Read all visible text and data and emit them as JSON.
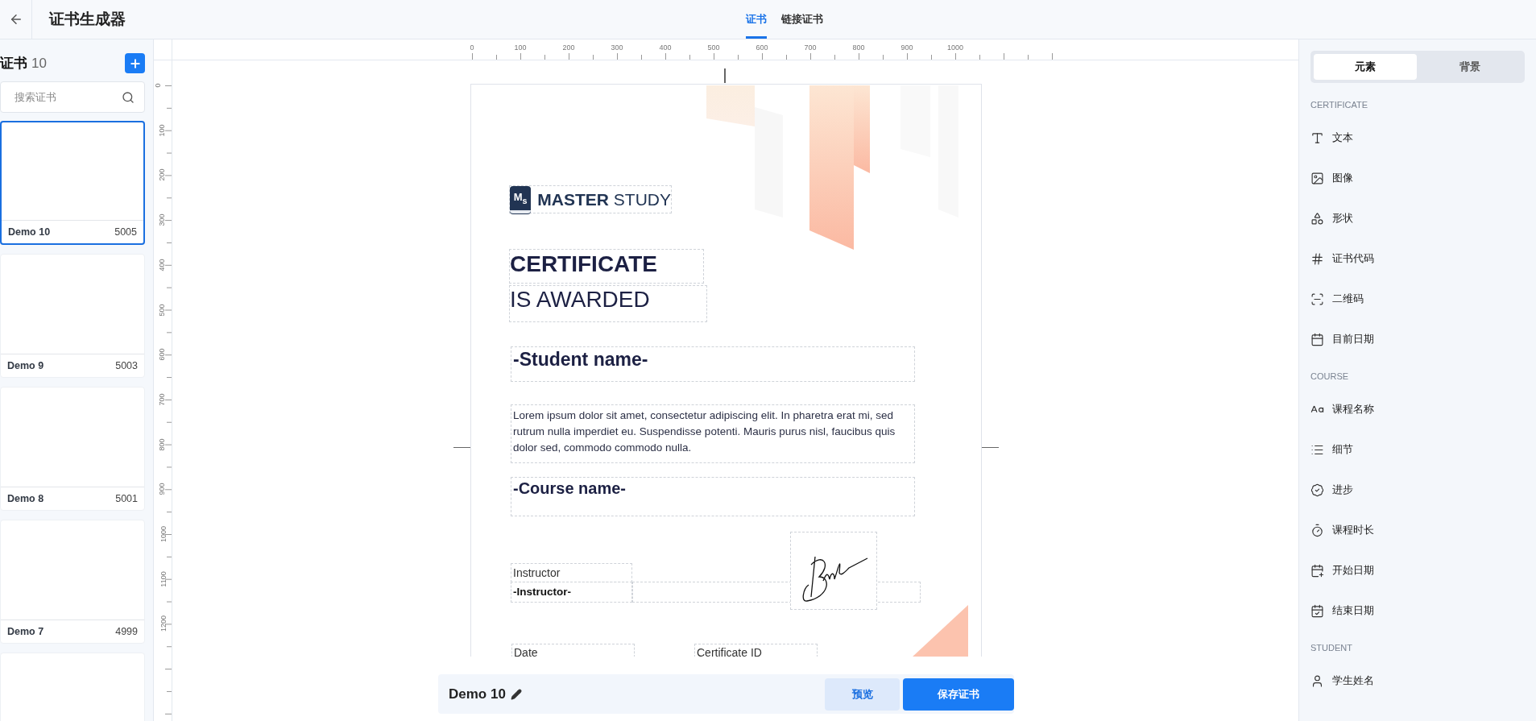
{
  "header": {
    "title": "证书生成器",
    "tabs": [
      {
        "label": "证书",
        "selected": true
      },
      {
        "label": "链接证书",
        "selected": false
      }
    ]
  },
  "sidebar": {
    "title": "证书",
    "count": "10",
    "search": {
      "placeholder": "搜索证书"
    },
    "items": [
      {
        "name": "Demo 10",
        "code": "5005",
        "selected": true
      },
      {
        "name": "Demo 9",
        "code": "5003",
        "selected": false
      },
      {
        "name": "Demo 8",
        "code": "5001",
        "selected": false
      },
      {
        "name": "Demo 7",
        "code": "4999",
        "selected": false
      },
      {
        "selected": false
      }
    ]
  },
  "rulers": {
    "horizontal": [
      "0",
      "100",
      "200",
      "300",
      "400",
      "500",
      "600",
      "700",
      "800",
      "900",
      "1000"
    ],
    "vertical": [
      "0",
      "100",
      "200",
      "300",
      "400",
      "500",
      "600",
      "700",
      "800",
      "900",
      "1000",
      "1100",
      "1200"
    ]
  },
  "certificate": {
    "logo": {
      "mark": "M$_{s}$",
      "bold": "MASTER",
      "light": "STUDY"
    },
    "title": "CERTIFICATE",
    "subtitle": "IS AWARDED",
    "student_name": "-Student name-",
    "description": "Lorem ipsum dolor sit amet, consectetur adipiscing elit. In pharetra erat mi, sed rutrum nulla imperdiet eu. Suspendisse potenti. Mauris purus nisl, faucibus quis dolor sed, commodo commodo nulla.",
    "course_name": "-Course name-",
    "instructor_label": "Instructor",
    "instructor_name": "-Instructor-",
    "date_label": "Date",
    "certificate_id_label": "Certificate ID"
  },
  "bottom_bar": {
    "name": "Demo 10",
    "buttons": [
      {
        "label": "预览",
        "kind": "secondary"
      },
      {
        "label": "保存证书",
        "kind": "primary"
      }
    ]
  },
  "panel": {
    "tabs": [
      {
        "label": "元素",
        "selected": true
      },
      {
        "label": "背景",
        "selected": false
      }
    ],
    "sections": [
      {
        "title": "CERTIFICATE",
        "items": [
          {
            "label": "文本",
            "kind": "text"
          },
          {
            "label": "图像",
            "kind": "image"
          },
          {
            "label": "形状",
            "kind": "shape"
          },
          {
            "label": "证书代码",
            "kind": "code"
          },
          {
            "label": "二维码",
            "kind": "qr"
          },
          {
            "label": "目前日期",
            "kind": "date"
          }
        ]
      },
      {
        "title": "COURSE",
        "items": [
          {
            "label": "课程名称",
            "kind": "font"
          },
          {
            "label": "细节",
            "kind": "list"
          },
          {
            "label": "进步",
            "kind": "progress"
          },
          {
            "label": "课程时长",
            "kind": "timer"
          },
          {
            "label": "开始日期",
            "kind": "start"
          },
          {
            "label": "结束日期",
            "kind": "end"
          }
        ]
      },
      {
        "title": "STUDENT",
        "items": [
          {
            "label": "学生姓名",
            "kind": "user"
          }
        ]
      }
    ]
  }
}
